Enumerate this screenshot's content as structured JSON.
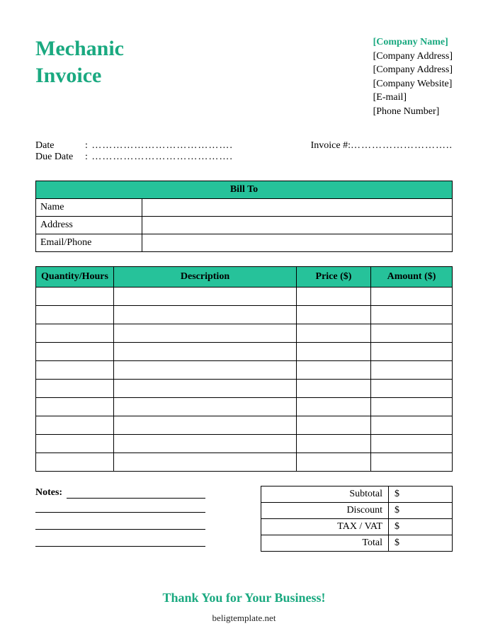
{
  "title_line1": "Mechanic",
  "title_line2": "Invoice",
  "company": {
    "name": "[Company Name]",
    "addr1": "[Company Address]",
    "addr2": "[Company Address]",
    "website": "[Company Website]",
    "email": "[E-mail]",
    "phone": "[Phone Number]"
  },
  "meta": {
    "date_label": "Date",
    "due_label": "Due Date",
    "dots": ": ………………………………….",
    "invoice_label": "Invoice #:",
    "invoice_dots": "……………………….."
  },
  "billto": {
    "header": "Bill To",
    "name_label": "Name",
    "address_label": "Address",
    "email_label": "Email/Phone"
  },
  "items_header": {
    "qty": "Quantity/Hours",
    "desc": "Description",
    "price": "Price ($)",
    "amount": "Amount ($)"
  },
  "notes_label": "Notes:",
  "totals": {
    "subtotal_label": "Subtotal",
    "discount_label": "Discount",
    "tax_label": "TAX / VAT",
    "total_label": "Total",
    "currency": "$"
  },
  "thankyou": "Thank You for Your Business!",
  "footer": "beligtemplate.net"
}
